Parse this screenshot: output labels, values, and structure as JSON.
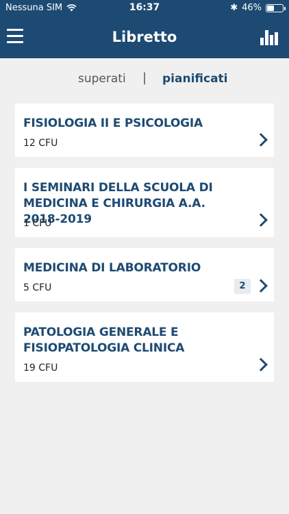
{
  "status_bar": {
    "carrier": "Nessuna SIM",
    "time": "16:37",
    "battery": "46%",
    "battery_level": 0.46
  },
  "header": {
    "title": "Libretto",
    "menu_icon": "hamburger-menu-icon",
    "stats_icon": "bar-chart-icon"
  },
  "tabs": {
    "superati": "superati",
    "separator": "|",
    "pianificati": "pianificati"
  },
  "courses": [
    {
      "title": "FISIOLOGIA II E PSICOLOGIA",
      "cfu": "12 CFU"
    },
    {
      "title": "I SEMINARI DELLA SCUOLA DI MEDICINA E CHIRURGIA A.A. 2018-2019",
      "cfu": "1 CFU"
    },
    {
      "title": "MEDICINA DI LABORATORIO",
      "cfu": "5 CFU",
      "badge": "2"
    },
    {
      "title": "PATOLOGIA GENERALE E FISIOPATOLOGIA CLINICA",
      "cfu": "19 CFU"
    }
  ],
  "colors": {
    "primary": "#1d4a73",
    "background": "#f0f0f0",
    "card": "#ffffff"
  }
}
